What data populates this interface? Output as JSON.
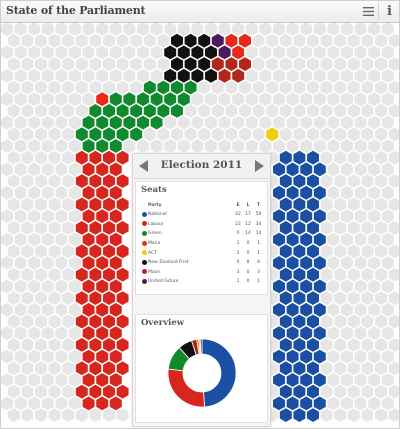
{
  "app": {
    "title": "State of the Parliament",
    "menu_icon": "hamburger-menu-icon",
    "info_icon": "info-icon",
    "info_glyph": "i"
  },
  "election": {
    "title": "Election 2011",
    "prev_icon": "left-arrow-icon",
    "next_icon": "right-arrow-icon"
  },
  "seats": {
    "title": "Seats",
    "headers": {
      "party": "Party",
      "electorate": "E",
      "list": "L",
      "total": "T"
    },
    "rows": [
      {
        "party": "National",
        "color": "#1a4fa3",
        "e": "42",
        "l": "17",
        "t": "59"
      },
      {
        "party": "Labour",
        "color": "#d7261e",
        "e": "22",
        "l": "12",
        "t": "34"
      },
      {
        "party": "Green",
        "color": "#108a2e",
        "e": "0",
        "l": "14",
        "t": "14"
      },
      {
        "party": "Mana",
        "color": "#e8281d",
        "e": "1",
        "l": "0",
        "t": "1"
      },
      {
        "party": "ACT",
        "color": "#f0cc0a",
        "e": "1",
        "l": "0",
        "t": "1"
      },
      {
        "party": "New Zealand First",
        "color": "#111111",
        "e": "0",
        "l": "8",
        "t": "8"
      },
      {
        "party": "Maori",
        "color": "#b2261c",
        "e": "3",
        "l": "0",
        "t": "3"
      },
      {
        "party": "United Future",
        "color": "#4b1a5c",
        "e": "1",
        "l": "0",
        "t": "1"
      }
    ]
  },
  "overview": {
    "title": "Overview"
  },
  "colors": {
    "empty_seat": "#e6e6e6"
  },
  "chart_data": {
    "type": "pie",
    "title": "",
    "categories": [
      "National",
      "Labour",
      "Green",
      "New Zealand First",
      "Maori",
      "Mana",
      "ACT",
      "United Future"
    ],
    "values": [
      59,
      34,
      14,
      8,
      3,
      1,
      1,
      1
    ],
    "colors": [
      "#1a4fa3",
      "#d7261e",
      "#108a2e",
      "#111111",
      "#b2261c",
      "#e8281d",
      "#f0cc0a",
      "#4b1a5c"
    ],
    "start": "top",
    "direction": "clockwise",
    "donut": true
  }
}
